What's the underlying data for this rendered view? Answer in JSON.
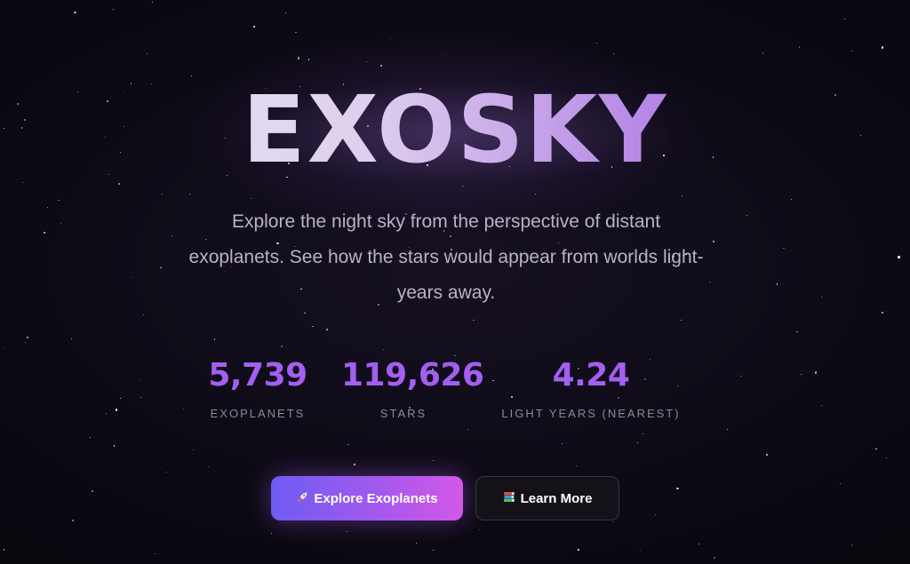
{
  "hero": {
    "title": "EXOSKY",
    "tagline": "Explore the night sky from the perspective of distant exoplanets. See how the stars would appear from worlds light-years away."
  },
  "stats": [
    {
      "value": "5,739",
      "label": "EXOPLANETS"
    },
    {
      "value": "119,626",
      "label": "STARS"
    },
    {
      "value": "4.24",
      "label": "LIGHT YEARS (NEAREST)"
    }
  ],
  "actions": {
    "primary": {
      "label": "Explore Exoplanets",
      "icon": "rocket-icon"
    },
    "secondary": {
      "label": "Learn More",
      "icon": "books-icon"
    }
  },
  "colors": {
    "accent": "#a35ff0",
    "background": "#0c0913",
    "primary_gradient_start": "#6e5cf2",
    "primary_gradient_end": "#d358e6"
  }
}
